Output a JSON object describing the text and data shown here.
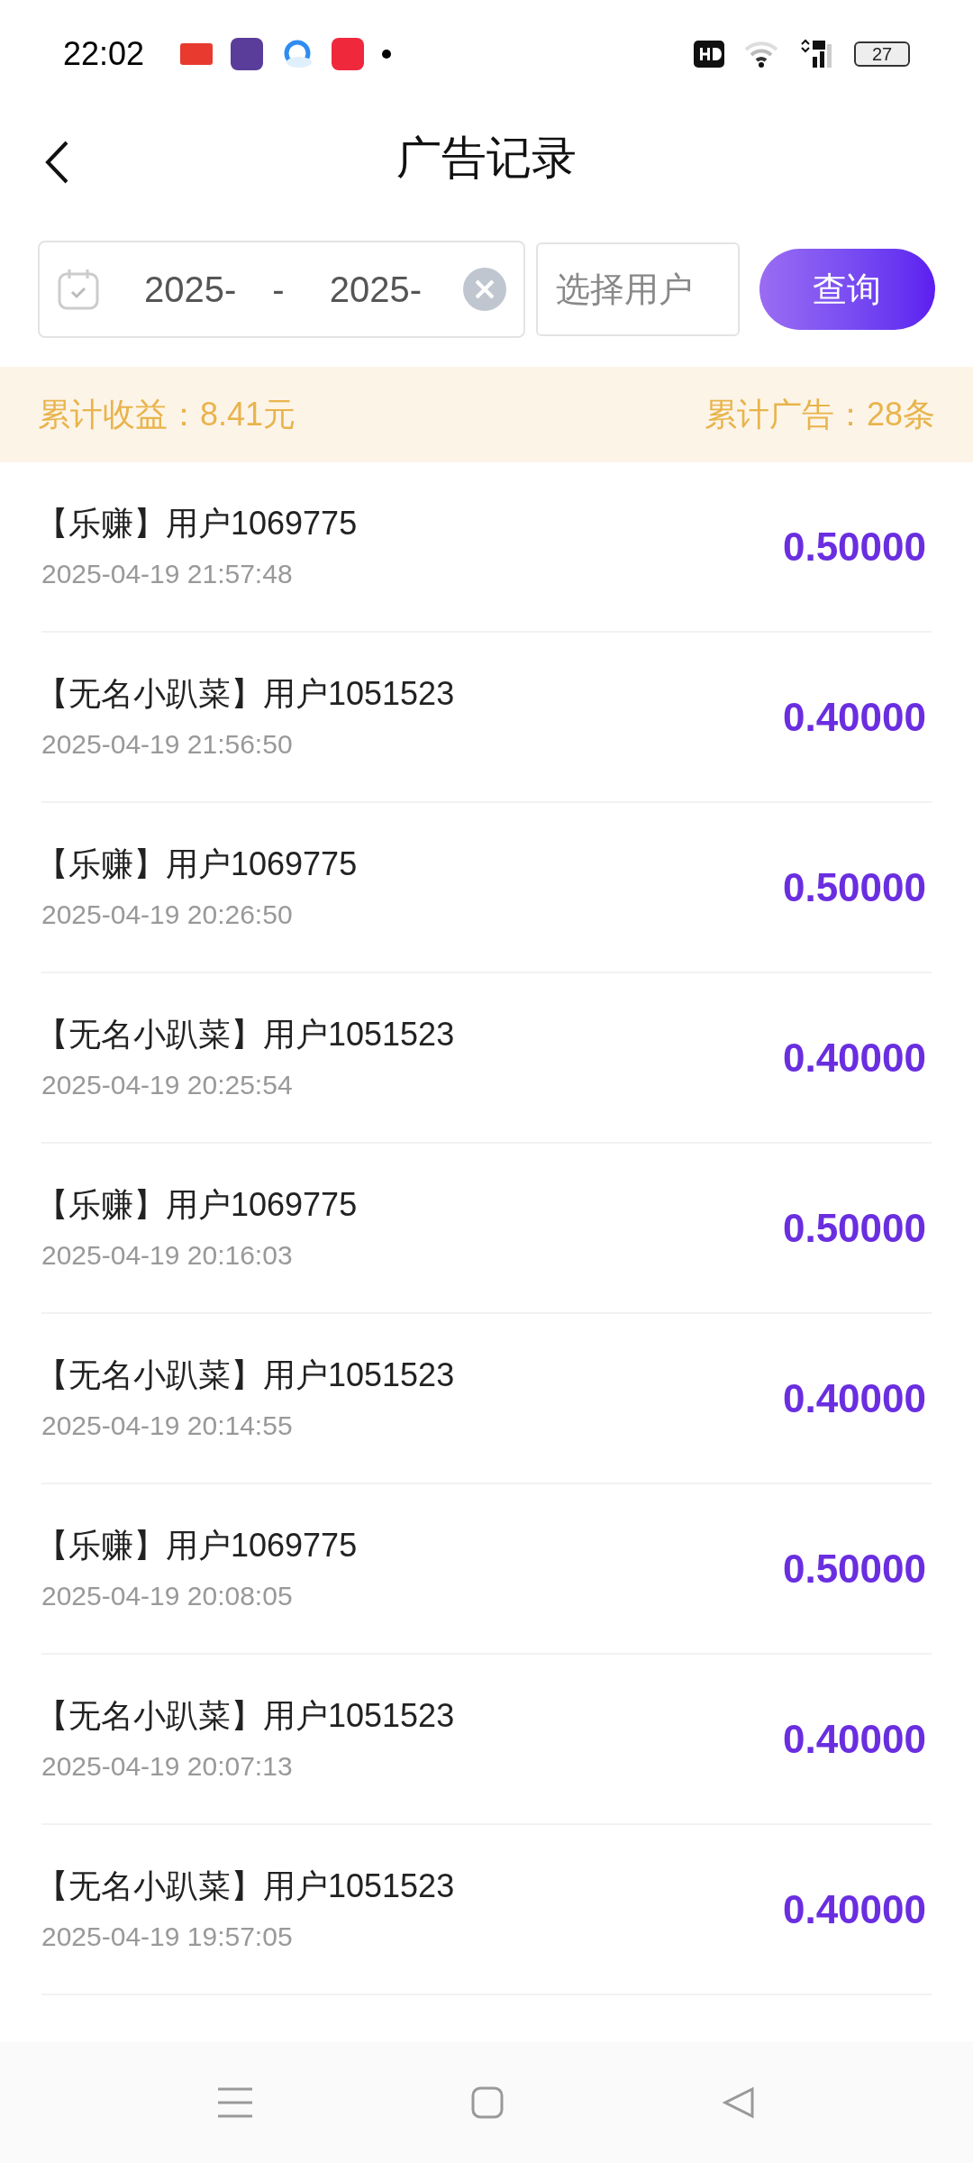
{
  "status_bar": {
    "time": "22:02",
    "battery": "27"
  },
  "header": {
    "title": "广告记录"
  },
  "filter": {
    "start_date": "2025-",
    "separator": "-",
    "end_date": "2025-",
    "user_placeholder": "选择用户",
    "query_button": "查询"
  },
  "summary": {
    "income": "累计收益：8.41元",
    "ads": "累计广告：28条"
  },
  "records": [
    {
      "title": "【乐赚】用户1069775",
      "time": "2025-04-19 21:57:48",
      "amount": "0.50000"
    },
    {
      "title": "【无名小趴菜】用户1051523",
      "time": "2025-04-19 21:56:50",
      "amount": "0.40000"
    },
    {
      "title": "【乐赚】用户1069775",
      "time": "2025-04-19 20:26:50",
      "amount": "0.50000"
    },
    {
      "title": "【无名小趴菜】用户1051523",
      "time": "2025-04-19 20:25:54",
      "amount": "0.40000"
    },
    {
      "title": "【乐赚】用户1069775",
      "time": "2025-04-19 20:16:03",
      "amount": "0.50000"
    },
    {
      "title": "【无名小趴菜】用户1051523",
      "time": "2025-04-19 20:14:55",
      "amount": "0.40000"
    },
    {
      "title": "【乐赚】用户1069775",
      "time": "2025-04-19 20:08:05",
      "amount": "0.50000"
    },
    {
      "title": "【无名小趴菜】用户1051523",
      "time": "2025-04-19 20:07:13",
      "amount": "0.40000"
    },
    {
      "title": "【无名小趴菜】用户1051523",
      "time": "2025-04-19 19:57:05",
      "amount": "0.40000"
    }
  ]
}
